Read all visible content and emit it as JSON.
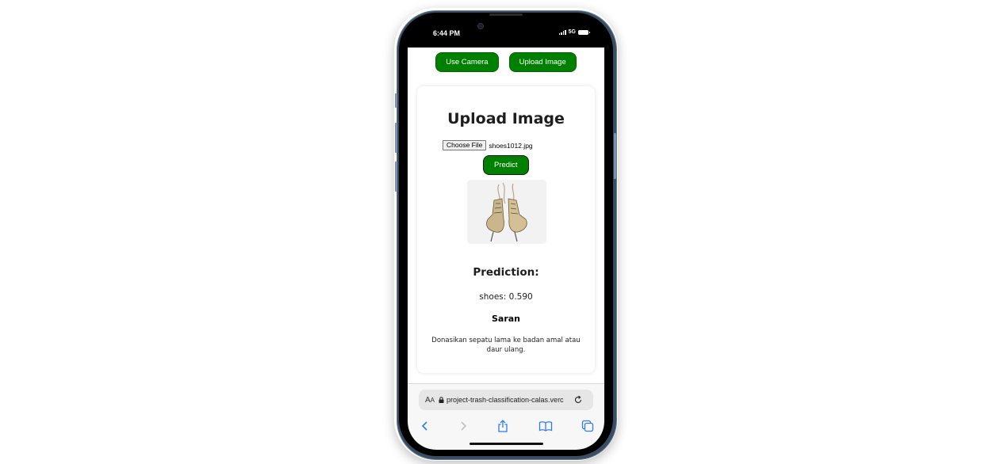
{
  "status_bar": {
    "time": "6:44 PM",
    "network": "5G"
  },
  "top_buttons": {
    "use_camera": "Use Camera",
    "upload_image": "Upload Image"
  },
  "card": {
    "title": "Upload Image",
    "choose_file_label": "Choose File",
    "file_name": "shoes1012.jpg",
    "predict_label": "Predict",
    "image_alt": "shoes",
    "prediction_title": "Prediction:",
    "prediction_value": "shoes: 0.590",
    "saran_title": "Saran",
    "saran_text": "Donasikan sepatu lama ke badan amal atau daur ulang."
  },
  "browser": {
    "text_size_label": "AA",
    "url": "project-trash-classification-calas.verc",
    "nav": [
      "back-icon",
      "forward-icon",
      "share-icon",
      "bookmarks-icon",
      "tabs-icon"
    ]
  },
  "colors": {
    "button_green": "#008000",
    "ios_blue": "#2f7bf5"
  }
}
